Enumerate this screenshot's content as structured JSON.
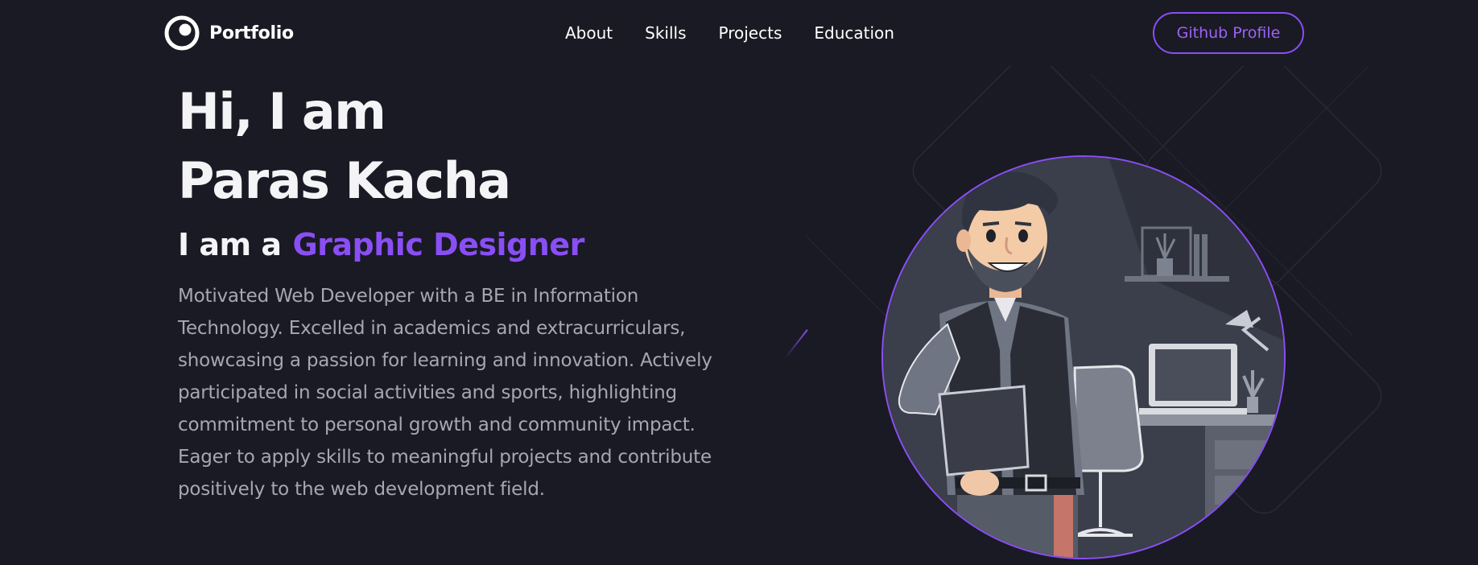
{
  "nav": {
    "brand": "Portfolio",
    "brand_icon": "portfolio-logo-icon",
    "links": [
      "About",
      "Skills",
      "Projects",
      "Education"
    ],
    "github_button": "Github Profile"
  },
  "hero": {
    "greeting": "Hi, I am",
    "name": "Paras Kacha",
    "role_prefix": "I am a",
    "role": "Graphic Designer",
    "bio": "Motivated Web Developer with a BE in Information Technology. Excelled in academics and extracurriculars, showcasing a passion for learning and innovation. Actively participated in social activities and sports, highlighting commitment to personal growth and community impact. Eager to apply skills to meaningful projects and contribute positively to the web development field.",
    "avatar_image": "developer-illustration"
  },
  "colors": {
    "background": "#1a1a24",
    "accent": "#8a4ef5",
    "text": "#f4f4f7",
    "muted_text": "#a7a7b2"
  }
}
